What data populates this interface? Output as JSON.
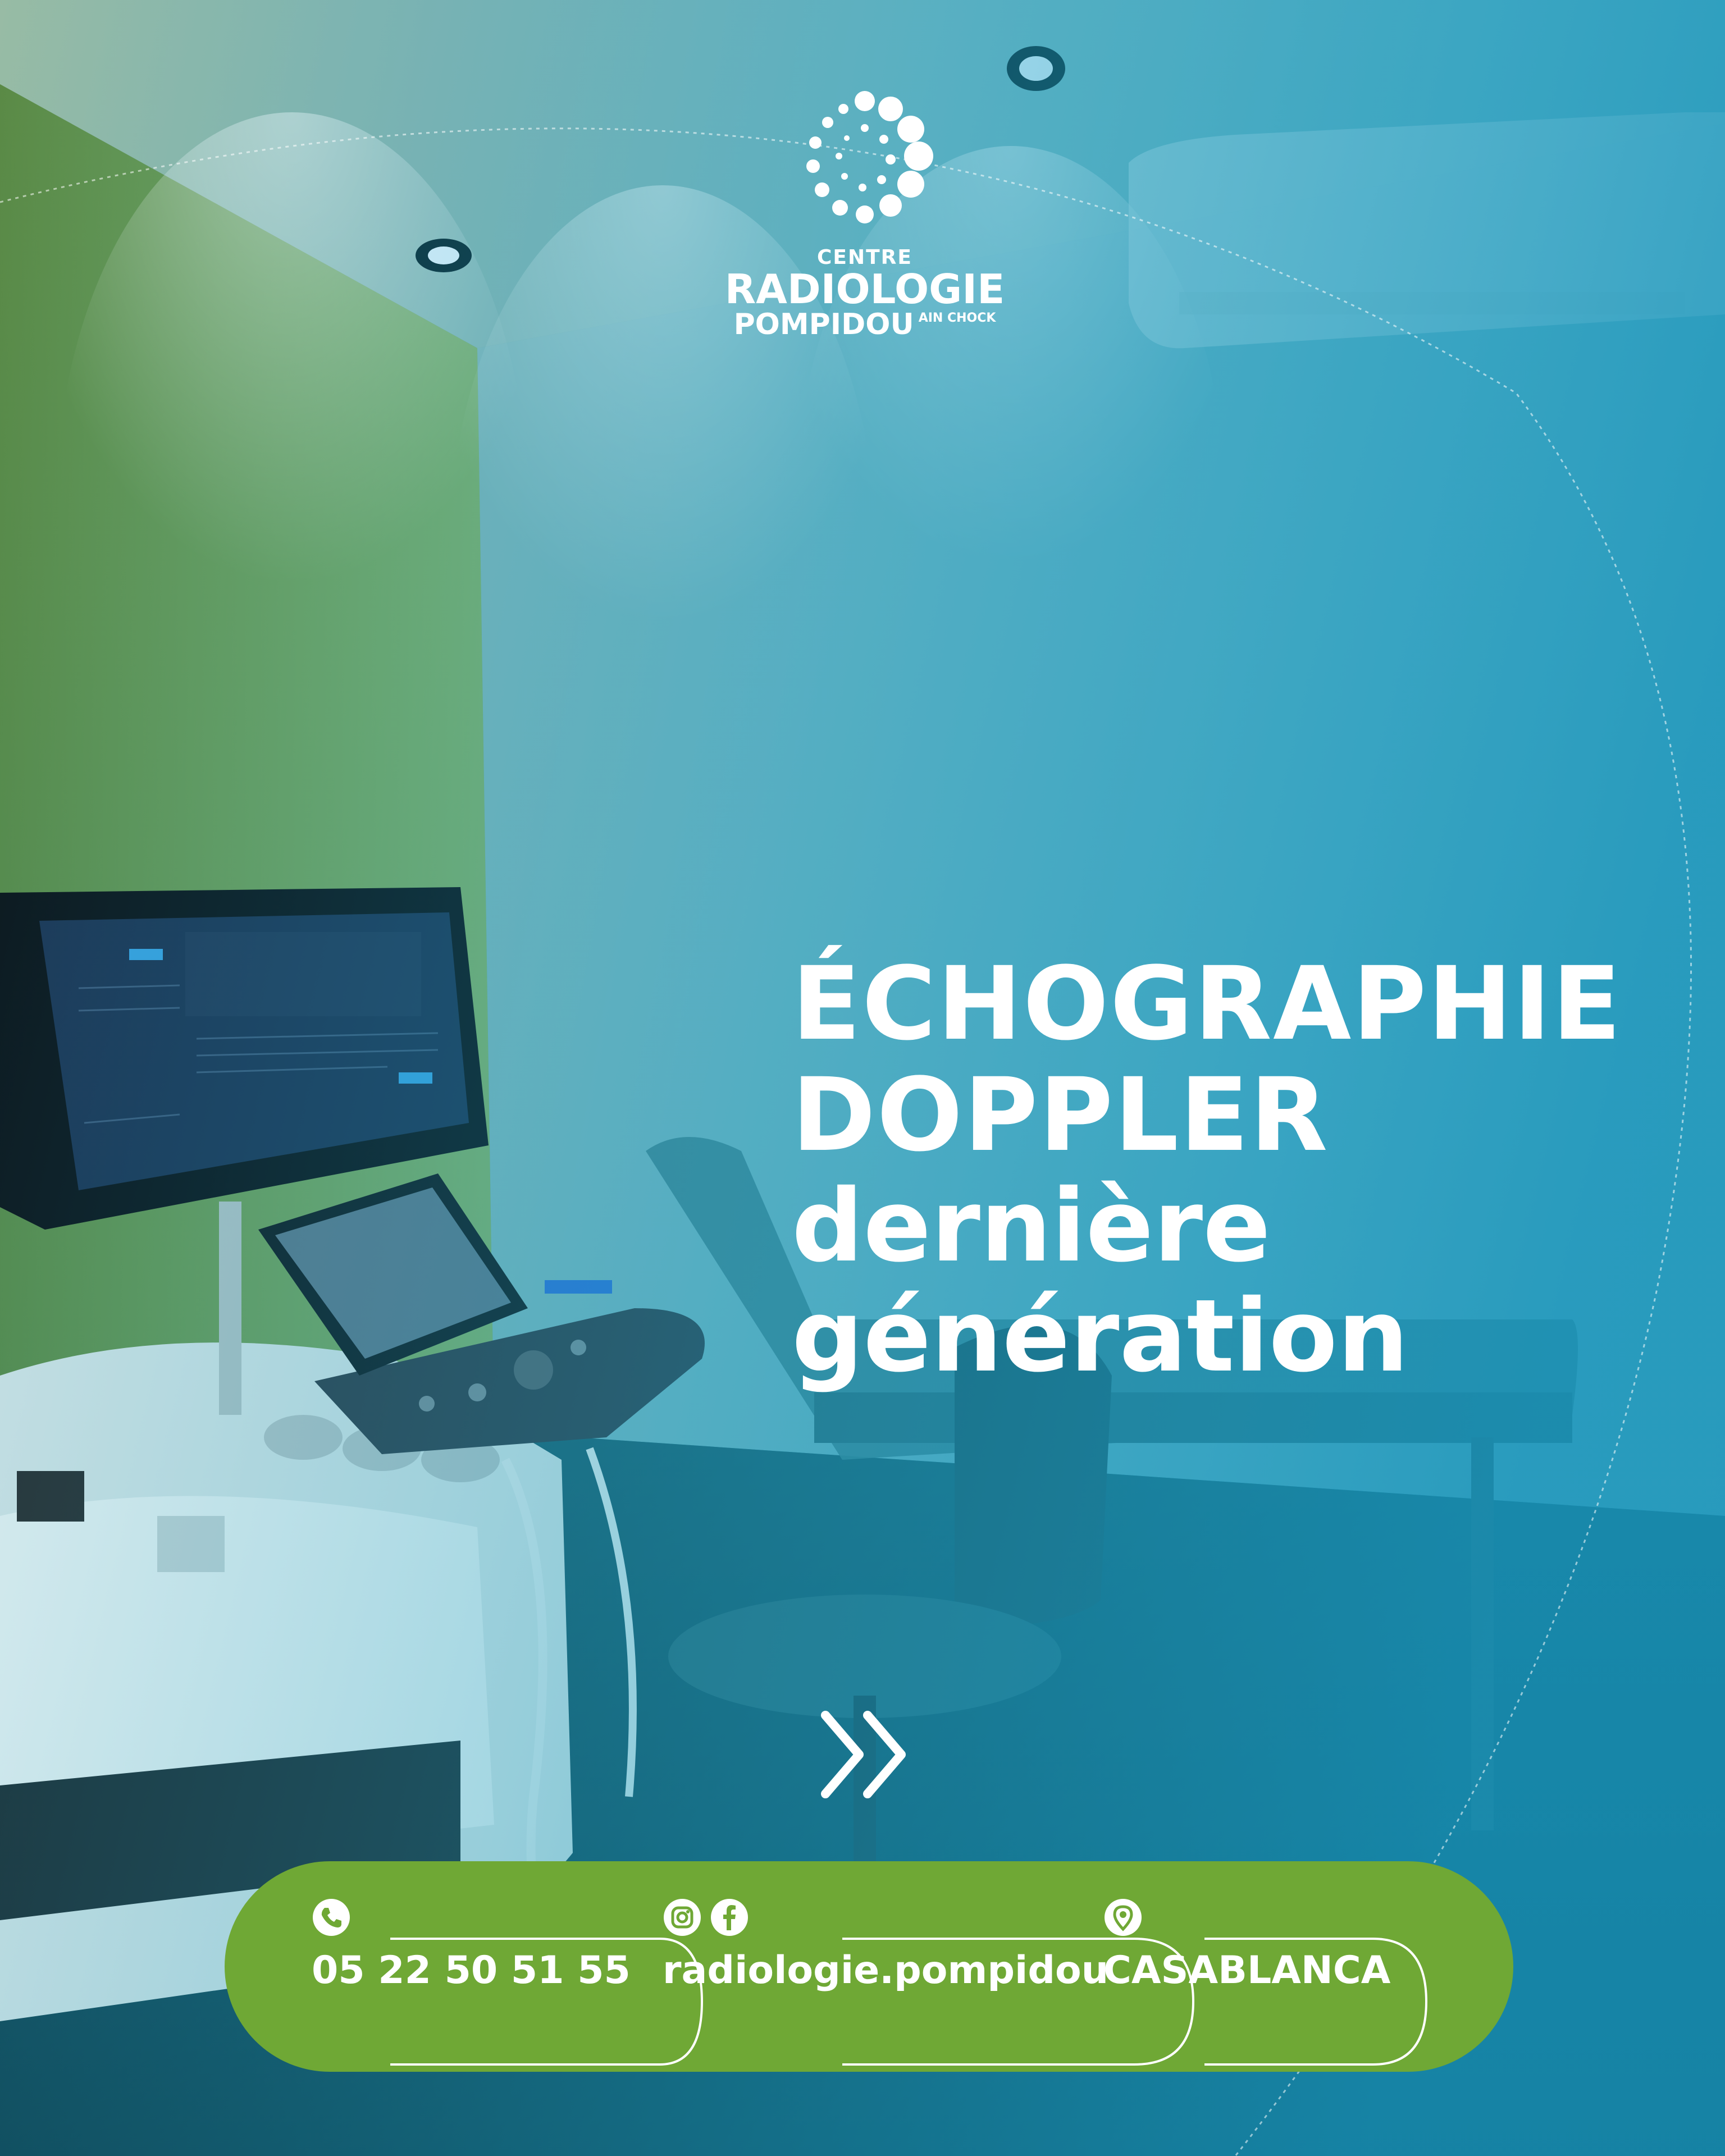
{
  "logo": {
    "line1": "CENTRE",
    "line2": "RADIOLOGIE",
    "line3": "POMPIDOU",
    "line3_suffix": "AIN CHOCK"
  },
  "headline": {
    "line1": "ÉCHOGRAPHIE",
    "line2": "DOPPLER",
    "line3": "dernière",
    "line4": "génération"
  },
  "contact": {
    "phone": "05 22 50 51 55",
    "social": "radiologie.pompidou",
    "city": "CASABLANCA"
  },
  "colors": {
    "bar_green": "#6fa835",
    "teal": "#1e97b6",
    "text": "#ffffff"
  },
  "icons": [
    "phone-icon",
    "instagram-icon",
    "facebook-icon",
    "location-pin-icon",
    "chevron-double-right-icon"
  ]
}
